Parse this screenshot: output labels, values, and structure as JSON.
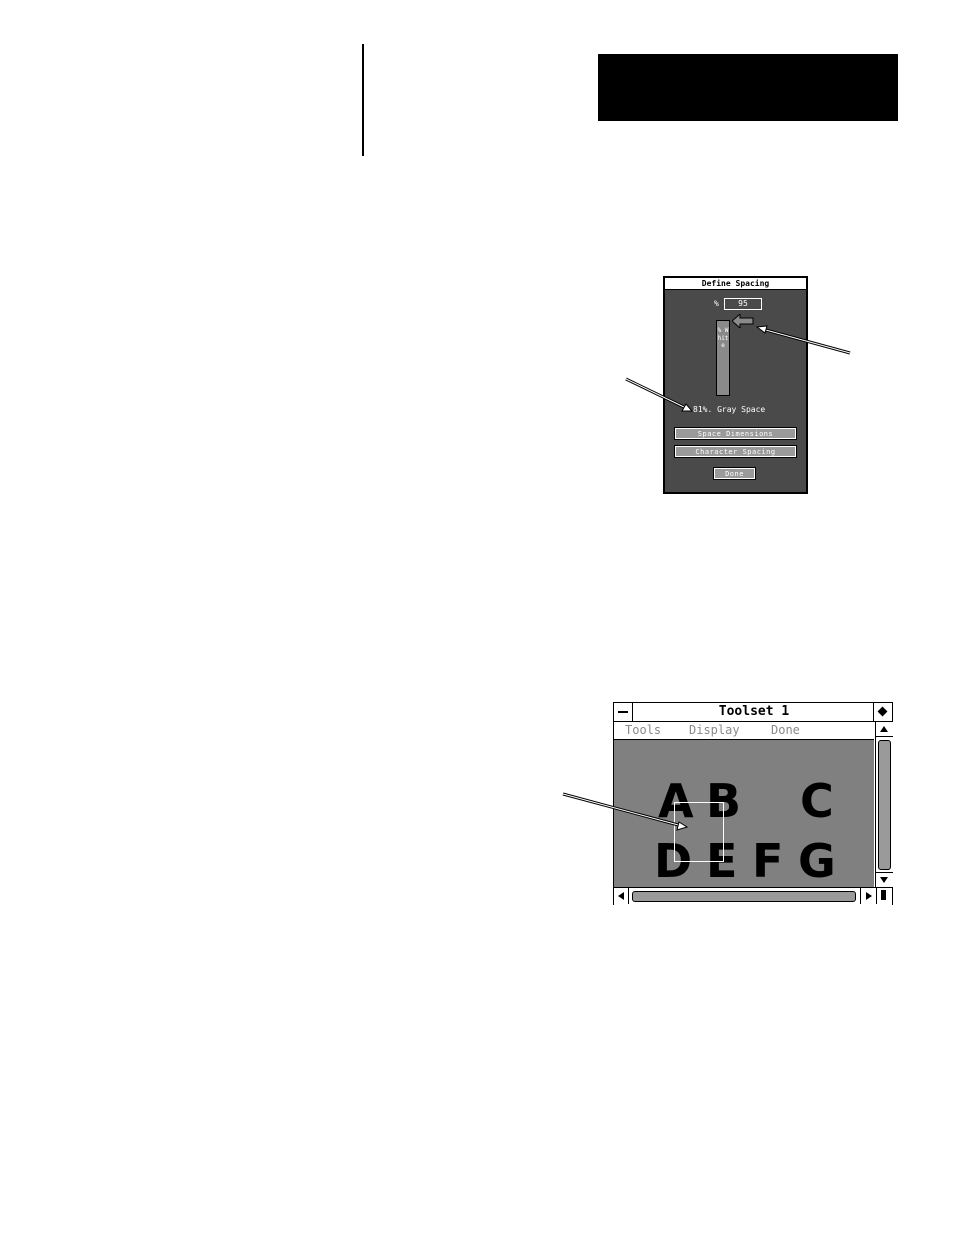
{
  "dialog": {
    "title": "Define Spacing",
    "percent_symbol": "%",
    "percent_value": "95",
    "slider_label": "% White",
    "gray_space_text": "81%. Gray Space",
    "buttons": {
      "space_dimensions": "Space Dimensions",
      "character_spacing": "Character Spacing",
      "done": "Done"
    }
  },
  "toolset": {
    "title": "Toolset 1",
    "menu": {
      "tools": "Tools",
      "display": "Display",
      "done": "Done"
    },
    "glyphs": {
      "a": "A",
      "b": "B",
      "c": "C",
      "d": "D",
      "e": "E",
      "f": "F",
      "g": "G"
    }
  },
  "colors": {
    "dialog_bg": "#4a4a4a",
    "canvas_bg": "#808080",
    "menu_text": "#8a8a8a"
  }
}
